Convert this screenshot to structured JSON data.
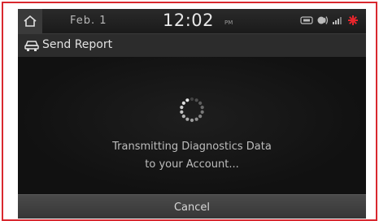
{
  "status_bar": {
    "date": "Feb.  1",
    "time": "12:02",
    "ampm": "PM",
    "icons": [
      "media-icon",
      "bluetooth-audio-icon",
      "signal-icon",
      "alert-icon"
    ]
  },
  "title_bar": {
    "icon": "car-icon",
    "title": "Send Report"
  },
  "content": {
    "message_line1": "Transmitting Diagnostics Data",
    "message_line2": "to your Account..."
  },
  "cancel_button": {
    "label": "Cancel"
  },
  "colors": {
    "frame_border": "#d9282f",
    "alert_icon": "#d9282f",
    "background": "#141414"
  }
}
